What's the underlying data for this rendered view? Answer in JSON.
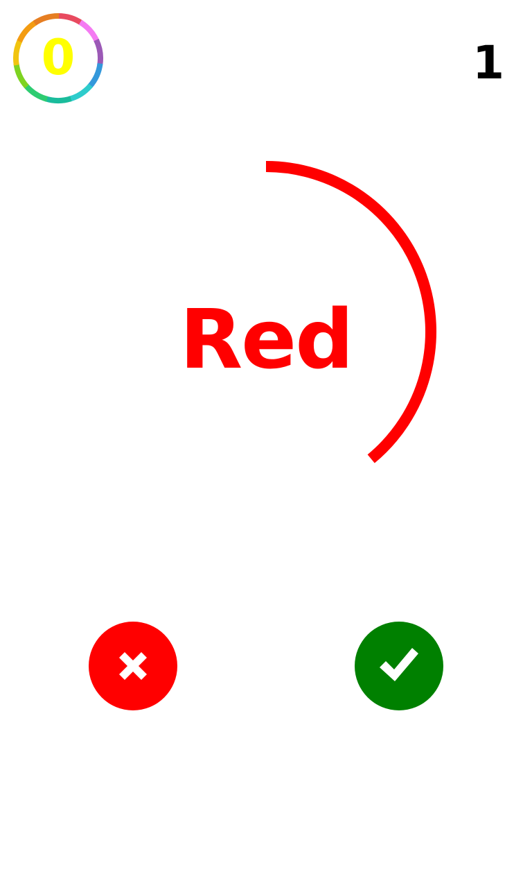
{
  "score": {
    "value": "0",
    "value_color": "#ffff00",
    "ring_colors": [
      "#e84a5f",
      "#f47af2",
      "#9b59b6",
      "#3498db",
      "#2ecccc",
      "#1abc9c",
      "#2ecc71",
      "#7ed321",
      "#f1c40f",
      "#f39c12",
      "#e67e22"
    ]
  },
  "level": {
    "value": "1"
  },
  "prompt": {
    "word": "Red",
    "word_color": "#ff0000"
  },
  "timer": {
    "remaining_fraction": 0.39,
    "color": "#ff0000"
  },
  "buttons": {
    "wrong": {
      "icon": "close-icon",
      "color": "#ff0000"
    },
    "right": {
      "icon": "checkmark-icon",
      "color": "#008000"
    }
  }
}
